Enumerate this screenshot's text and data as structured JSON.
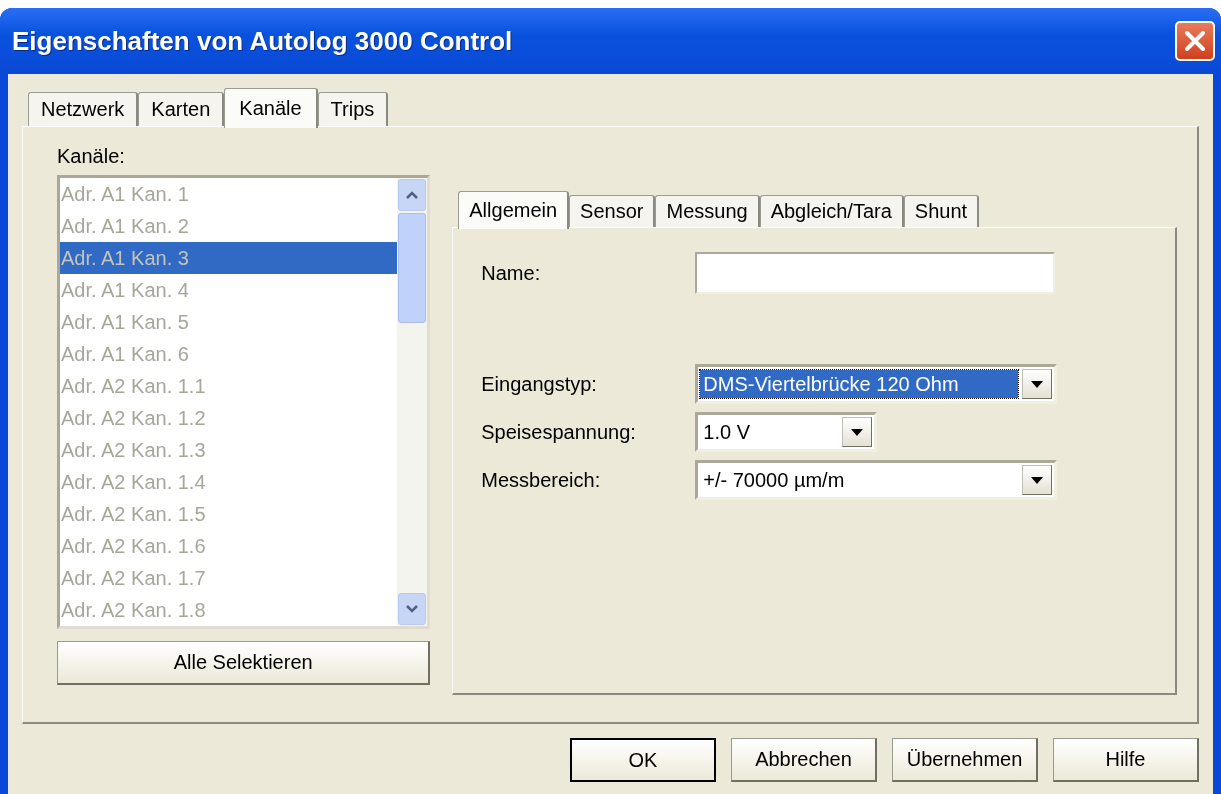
{
  "window": {
    "title": "Eigenschaften von Autolog 3000 Control"
  },
  "tabs": [
    {
      "label": "Netzwerk",
      "selected": false
    },
    {
      "label": "Karten",
      "selected": false
    },
    {
      "label": "Kanäle",
      "selected": true
    },
    {
      "label": "Trips",
      "selected": false
    }
  ],
  "channels": {
    "label": "Kanäle:",
    "items": [
      {
        "label": "Adr. A1 Kan. 1",
        "selected": false
      },
      {
        "label": "Adr. A1 Kan. 2",
        "selected": false
      },
      {
        "label": "Adr. A1 Kan. 3",
        "selected": true
      },
      {
        "label": "Adr. A1 Kan. 4",
        "selected": false
      },
      {
        "label": "Adr. A1 Kan. 5",
        "selected": false
      },
      {
        "label": "Adr. A1 Kan. 6",
        "selected": false
      },
      {
        "label": "Adr. A2 Kan. 1.1",
        "selected": false
      },
      {
        "label": "Adr. A2 Kan. 1.2",
        "selected": false
      },
      {
        "label": "Adr. A2 Kan. 1.3",
        "selected": false
      },
      {
        "label": "Adr. A2 Kan. 1.4",
        "selected": false
      },
      {
        "label": "Adr. A2 Kan. 1.5",
        "selected": false
      },
      {
        "label": "Adr. A2 Kan. 1.6",
        "selected": false
      },
      {
        "label": "Adr. A2 Kan. 1.7",
        "selected": false
      },
      {
        "label": "Adr. A2 Kan. 1.8",
        "selected": false
      }
    ]
  },
  "select_all_button": "Alle Selektieren",
  "subtabs": [
    {
      "label": "Allgemein",
      "selected": true
    },
    {
      "label": "Sensor",
      "selected": false
    },
    {
      "label": "Messung",
      "selected": false
    },
    {
      "label": "Abgleich/Tara",
      "selected": false
    },
    {
      "label": "Shunt",
      "selected": false
    }
  ],
  "fields": [
    {
      "kind": "text",
      "label": "Name:"
    },
    {
      "kind": "dropdown",
      "label": "Eingangstyp:",
      "value": "DMS-Viertelbrücke 120 Ohm",
      "focused": true,
      "narrow": false
    },
    {
      "kind": "dropdown",
      "label": "Speisespannung:",
      "value": "1.0 V",
      "focused": false,
      "narrow": true
    },
    {
      "kind": "dropdown",
      "label": "Messbereich:",
      "value": "+/- 70000 µm/m",
      "focused": false,
      "narrow": false
    }
  ],
  "buttons": [
    {
      "label": "OK",
      "default": true
    },
    {
      "label": "Abbrechen",
      "default": false
    },
    {
      "label": "Übernehmen",
      "default": false
    },
    {
      "label": "Hilfe",
      "default": false
    }
  ]
}
